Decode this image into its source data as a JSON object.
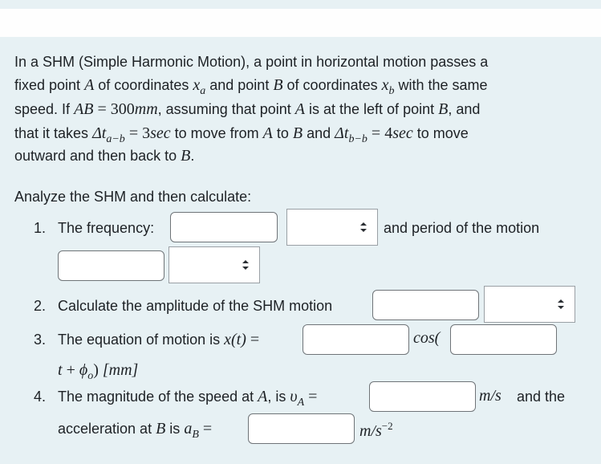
{
  "problem": {
    "line1": "In a SHM (Simple Harmonic Motion), a point in horizontal motion passes a",
    "line2_a": "fixed point ",
    "pointA": "A",
    "line2_b": " of coordinates ",
    "xa_base": "x",
    "xa_sub": "a",
    "line2_c": " and point ",
    "pointB": "B",
    "line2_d": " of coordinates ",
    "xb_base": "x",
    "xb_sub": "b",
    "line2_e": " with the same",
    "line3_a": "speed. If ",
    "AB": "AB",
    "eq": " = ",
    "dist_num": "300",
    "dist_unit": "mm",
    "line3_b": ", assuming that point ",
    "line3_c": " is at the left of point ",
    "line3_d": ", and",
    "line4_a": "that it takes ",
    "delta": "Δt",
    "dt1_sub": "a−b",
    "dt1_num": "3",
    "dt1_unit": "sec",
    "line4_b": " to move from ",
    "to": " to ",
    "and": " and ",
    "dt2_sub": "b−b",
    "dt2_num": "4",
    "dt2_unit": "sec",
    "line4_c": " to move",
    "line5": "outward and then back to ",
    "period": "."
  },
  "instructions": "Analyze the SHM and then calculate:",
  "q1": {
    "num": "1.",
    "label": "The frequency:",
    "frequency_value": "",
    "frequency_unit_selected": "",
    "after": "and period of the motion",
    "period_value": "",
    "period_unit_selected": ""
  },
  "q2": {
    "num": "2.",
    "label": "Calculate the amplitude of the SHM motion",
    "amplitude_value": "",
    "amplitude_unit_selected": ""
  },
  "q3": {
    "num": "3.",
    "label": "The equation of motion is ",
    "xt": "x(t)",
    "eq": " =",
    "amp_value": "",
    "cos": "cos(",
    "omega_value": "",
    "tail_t": "t",
    "tail_plus": " + ",
    "phi": "ϕ",
    "phi_sub": "o",
    "tail_close": ") ",
    "tail_unit": "[mm]"
  },
  "q4": {
    "num": "4.",
    "label": "The magnitude of the speed at ",
    "pointA": "A",
    "is": ", is ",
    "vA_base": "υ",
    "vA_sub": "A",
    "eq": " =",
    "speed_value": "",
    "speed_unit": "m/s",
    "and_the": "and the",
    "accel_label": "acceleration at ",
    "pointB": "B",
    "is2": " is ",
    "aB_base": "a",
    "aB_sub": "B",
    "accel_value": "",
    "accel_unit": "m/s",
    "accel_unit_exp": "−2"
  }
}
